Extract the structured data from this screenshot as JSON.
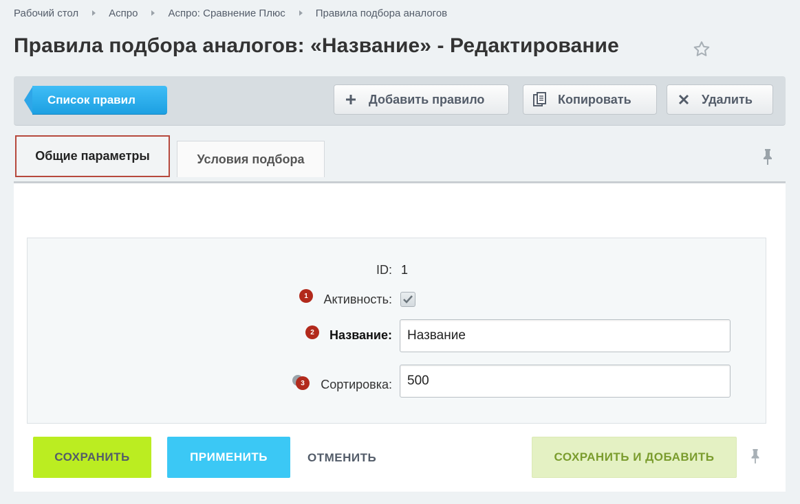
{
  "breadcrumb": [
    "Рабочий стол",
    "Аспро",
    "Аспро: Сравнение Плюс",
    "Правила подбора аналогов"
  ],
  "page_title": "Правила подбора аналогов: «Название» - Редактирование",
  "toolbar": {
    "list_label": "Список правил",
    "add_label": "Добавить правило",
    "copy_label": "Копировать",
    "delete_label": "Удалить"
  },
  "tabs": [
    {
      "label": "Общие параметры",
      "active": true
    },
    {
      "label": "Условия подбора",
      "active": false
    }
  ],
  "form": {
    "id_label": "ID:",
    "id_value": "1",
    "active_label": "Активность:",
    "active_checked": true,
    "name_label": "Название:",
    "name_value": "Название",
    "sort_label": "Сортировка:",
    "sort_value": "500"
  },
  "badges": [
    "1",
    "2",
    "3"
  ],
  "buttons": {
    "save": "СОХРАНИТЬ",
    "apply": "ПРИМЕНИТЬ",
    "cancel": "ОТМЕНИТЬ",
    "save_add": "СОХРАНИТЬ И ДОБАВИТЬ"
  },
  "colors": {
    "accent_blue": "#3bc8f5",
    "save_green": "#bbed21",
    "badge_red": "#b22a1c",
    "active_tab_border": "#b6483c"
  },
  "icons": [
    "star-icon",
    "plus-icon",
    "copy-icon",
    "close-icon",
    "pin-icon",
    "check-icon"
  ]
}
